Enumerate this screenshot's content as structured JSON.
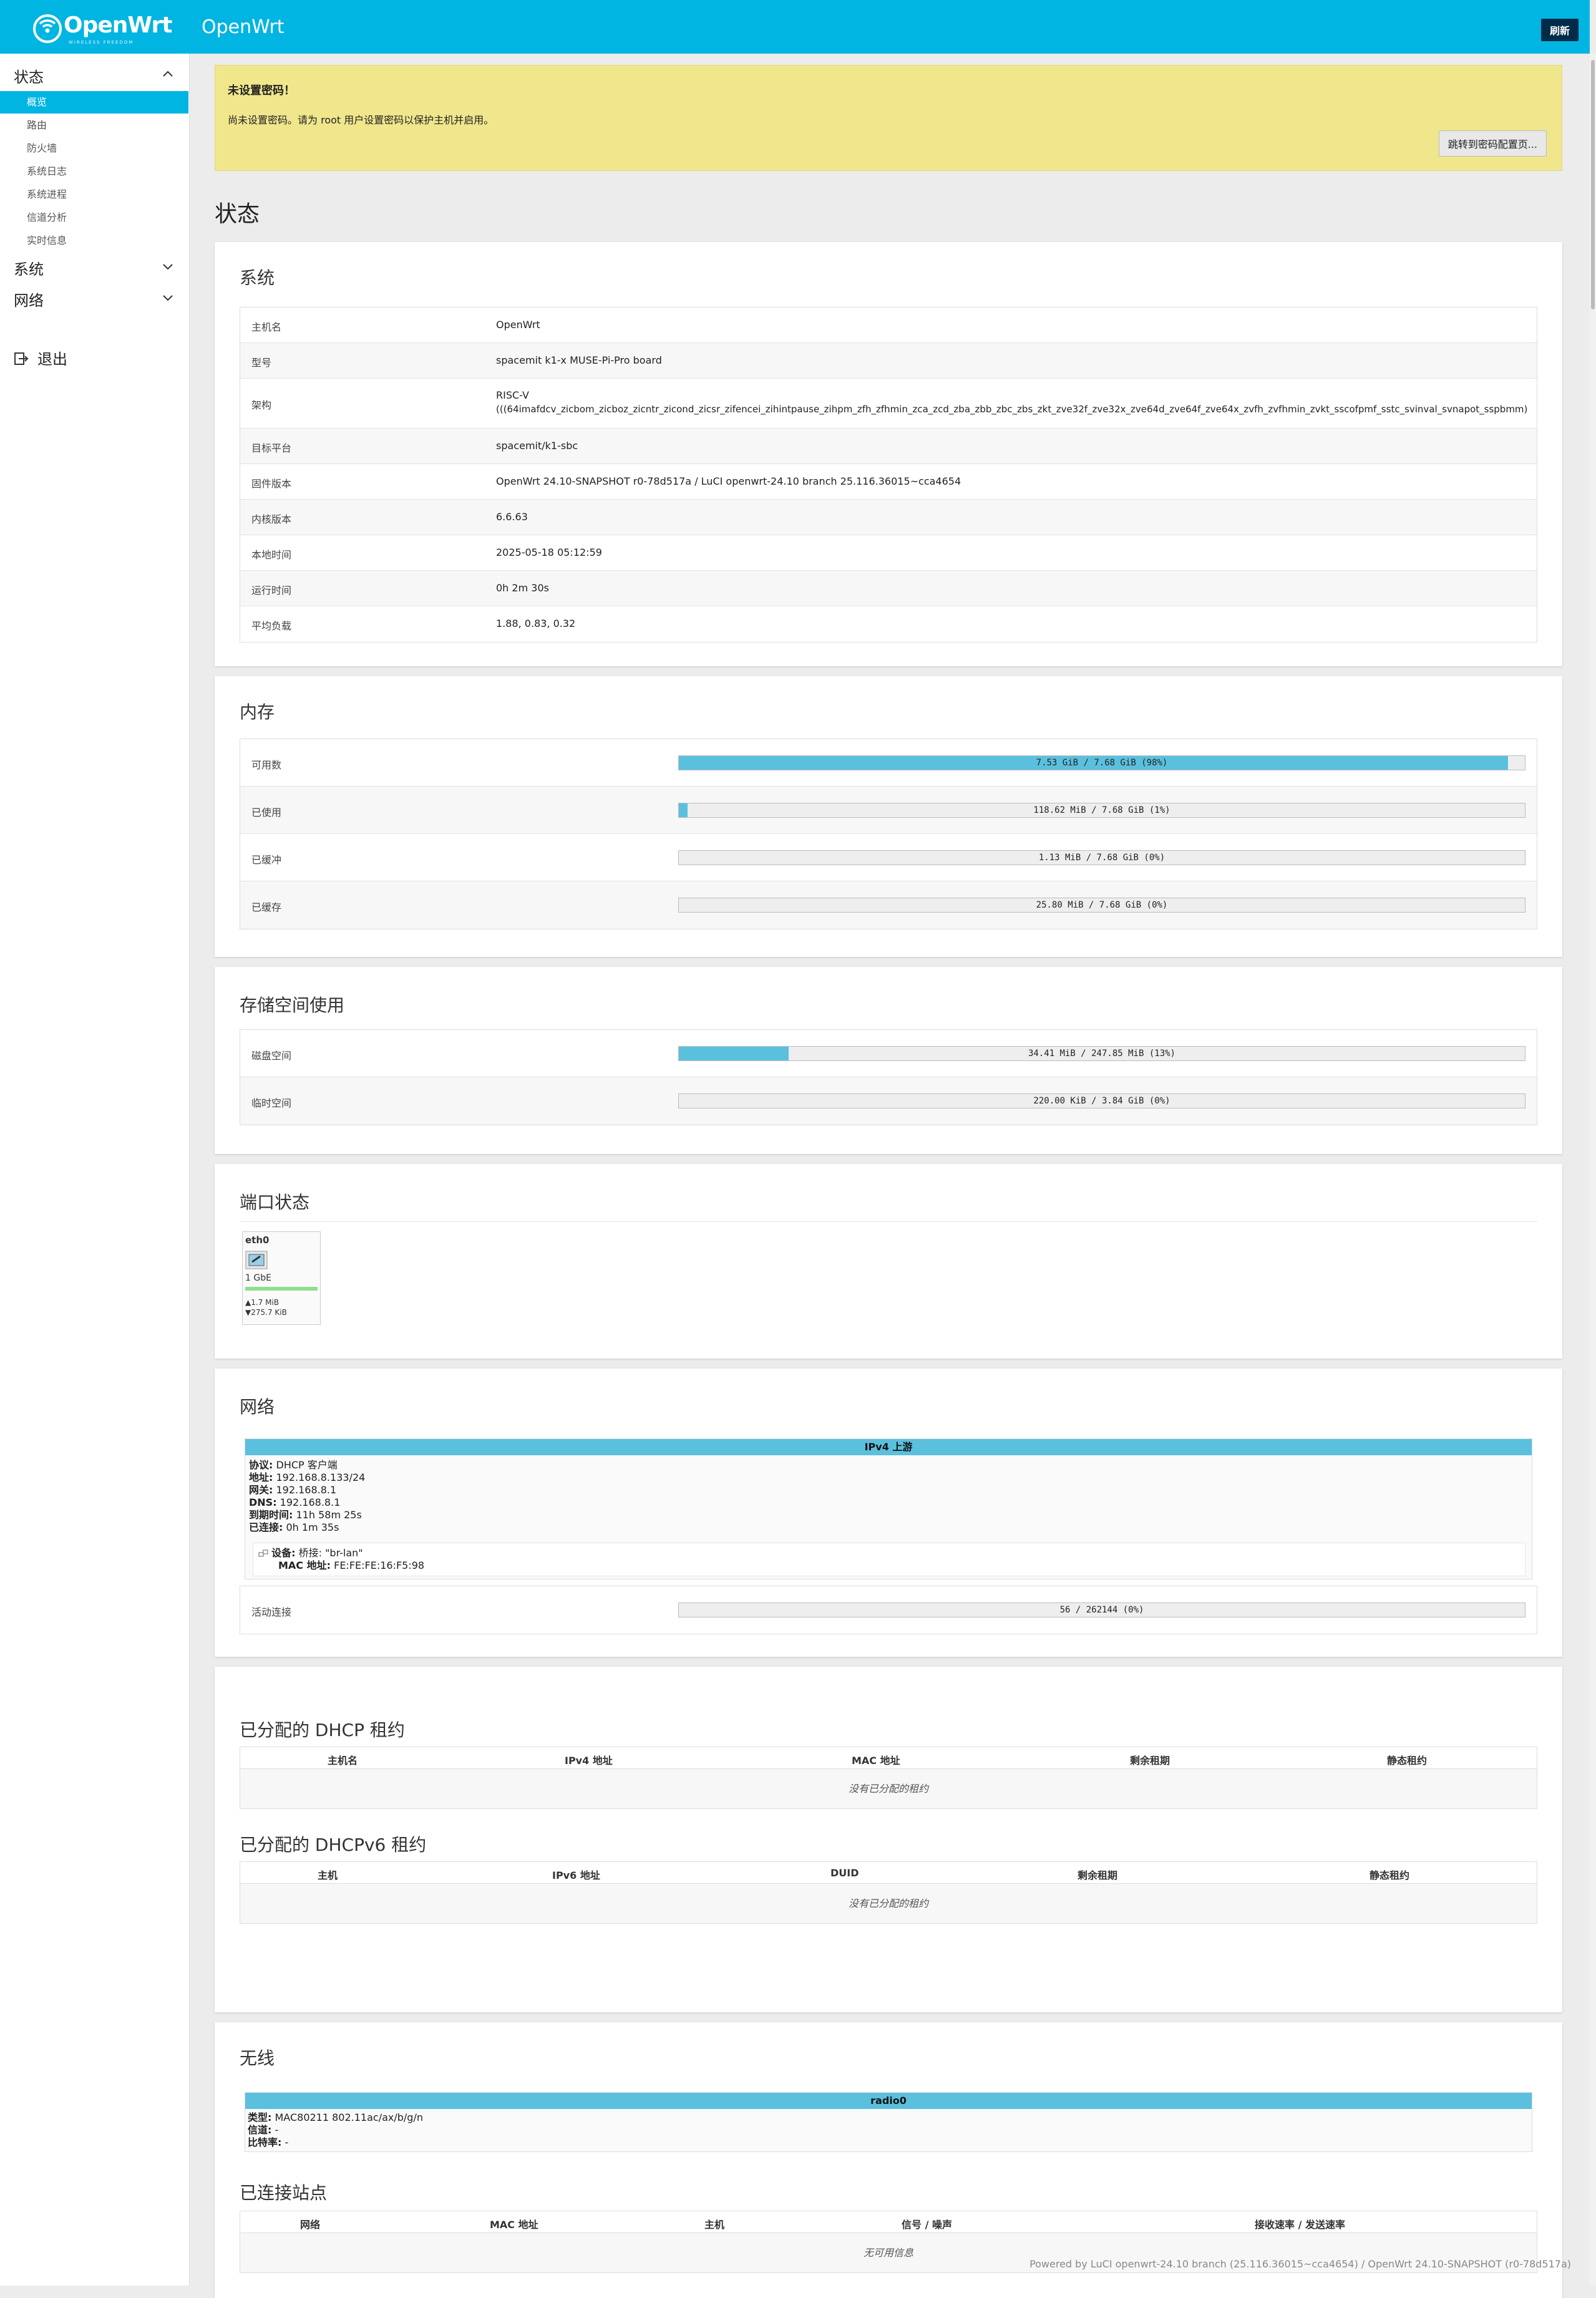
{
  "header": {
    "logo_text": "OpenWrt",
    "logo_sub": "WIRELESS FREEDOM",
    "brand": "OpenWrt",
    "refresh_label": "刷新",
    "accent": "#00b5e2"
  },
  "sidebar": {
    "status": "状态",
    "status_items": [
      "概览",
      "路由",
      "防火墙",
      "系统日志",
      "系统进程",
      "信道分析",
      "实时信息"
    ],
    "system": "系统",
    "network": "网络",
    "logout": "退出"
  },
  "alert": {
    "title": "未设置密码！",
    "text": "尚未设置密码。请为 root 用户设置密码以保护主机并启用。",
    "button": "跳转到密码配置页..."
  },
  "page_title": "状态",
  "system": {
    "title": "系统",
    "rows": [
      {
        "k": "主机名",
        "v": "OpenWrt"
      },
      {
        "k": "型号",
        "v": "spacemit k1-x MUSE-Pi-Pro board"
      },
      {
        "k": "架构",
        "v": "RISC-V",
        "v2": "(((64imafdcv_zicbom_zicboz_zicntr_zicond_zicsr_zifencei_zihintpause_zihpm_zfh_zfhmin_zca_zcd_zba_zbb_zbc_zbs_zkt_zve32f_zve32x_zve64d_zve64f_zve64x_zvfh_zvfhmin_zvkt_sscofpmf_sstc_svinval_svnapot_sspbmm)"
      },
      {
        "k": "目标平台",
        "v": "spacemit/k1-sbc"
      },
      {
        "k": "固件版本",
        "v": "OpenWrt 24.10-SNAPSHOT r0-78d517a / LuCI openwrt-24.10 branch 25.116.36015~cca4654"
      },
      {
        "k": "内核版本",
        "v": "6.6.63"
      },
      {
        "k": "本地时间",
        "v": "2025-05-18 05:12:59"
      },
      {
        "k": "运行时间",
        "v": "0h 2m 30s"
      },
      {
        "k": "平均负载",
        "v": "1.88, 0.83, 0.32"
      }
    ]
  },
  "memory": {
    "title": "内存",
    "rows": [
      {
        "k": "可用数",
        "label": "7.53 GiB / 7.68 GiB (98%)",
        "fill": 0.98
      },
      {
        "k": "已使用",
        "label": "118.62 MiB / 7.68 GiB (1%)",
        "fill": 0.01
      },
      {
        "k": "已缓冲",
        "label": "1.13 MiB / 7.68 GiB (0%)",
        "fill": 0
      },
      {
        "k": "已缓存",
        "label": "25.80 MiB / 7.68 GiB (0%)",
        "fill": 0
      }
    ]
  },
  "storage": {
    "title": "存储空间使用",
    "rows": [
      {
        "k": "磁盘空间",
        "label": "34.41 MiB / 247.85 MiB (13%)",
        "fill": 0.13
      },
      {
        "k": "临时空间",
        "label": "220.00 KiB / 3.84 GiB (0%)",
        "fill": 0
      }
    ]
  },
  "ports": {
    "title": "端口状态",
    "name": "eth0",
    "speed": "1 GbE",
    "tx": "▲1.7 MiB",
    "rx": "▼275.7 KiB"
  },
  "network": {
    "title": "网络",
    "band": "IPv4 上游",
    "lines": [
      {
        "k": "协议:",
        "v": " DHCP 客户端"
      },
      {
        "k": "地址:",
        "v": " 192.168.8.133/24"
      },
      {
        "k": "网关:",
        "v": " 192.168.8.1"
      },
      {
        "k": "DNS:",
        "v": " 192.168.8.1"
      },
      {
        "k": "到期时间:",
        "v": " 11h 58m 25s"
      },
      {
        "k": "已连接:",
        "v": " 0h 1m 35s"
      }
    ],
    "device_k": "设备:",
    "device_v": " 桥接: \"br-lan\"",
    "mac_k": "MAC 地址:",
    "mac_v": " FE:FE:FE:16:F5:98",
    "conn_k": "活动连接",
    "conn_label": "56 / 262144 (0%)",
    "conn_fill": 0
  },
  "dhcp": {
    "title": "已分配的 DHCP 租约",
    "cols": [
      "主机名",
      "IPv4 地址",
      "MAC 地址",
      "剩余租期",
      "静态租约"
    ],
    "empty": "没有已分配的租约",
    "title6": "已分配的 DHCPv6 租约",
    "cols6": [
      "主机",
      "IPv6 地址",
      "DUID",
      "剩余租期",
      "静态租约"
    ],
    "empty6": "没有已分配的租约"
  },
  "wireless": {
    "title": "无线",
    "band": "radio0",
    "lines": [
      {
        "k": "类型:",
        "v": " MAC80211 802.11ac/ax/b/g/n"
      },
      {
        "k": "信道:",
        "v": " -"
      },
      {
        "k": "比特率:",
        "v": " -"
      }
    ],
    "sta_title": "已连接站点",
    "sta_cols": [
      "网络",
      "MAC 地址",
      "主机",
      "信号 / 噪声",
      "接收速率 / 发送速率"
    ],
    "sta_empty": "无可用信息"
  },
  "footer": "Powered by LuCI openwrt-24.10 branch (25.116.36015~cca4654) / OpenWrt 24.10-SNAPSHOT (r0-78d517a)"
}
